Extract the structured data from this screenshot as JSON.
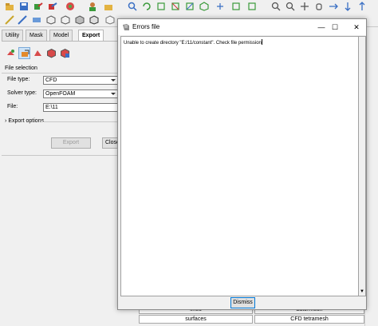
{
  "panel": {
    "tabs": [
      "Utility",
      "Mask",
      "Model",
      "Export"
    ],
    "active_tab": "Export",
    "section_title": "File selection",
    "fields": [
      {
        "label": "File type:",
        "value": "CFD",
        "kind": "combo"
      },
      {
        "label": "Solver type:",
        "value": "OpenFOAM",
        "kind": "combo"
      },
      {
        "label": "File:",
        "value": "E:\\11",
        "kind": "text"
      }
    ],
    "export_options_label": "Export options",
    "export_button": "Export",
    "close_button": "Close"
  },
  "bottom_table": {
    "row1": [
      "lines",
      "autormesh"
    ],
    "row2": [
      "surfaces",
      "CFD tetramesh"
    ]
  },
  "dialog": {
    "title": "Errors file",
    "minimize": "—",
    "maximize": "☐",
    "close": "✕",
    "message": "Unable to create directory \"E:/11/constant\". Check file permission",
    "dismiss_label": "Dismiss"
  },
  "colors": {
    "accent": "#0078d7",
    "selected_icon_bg": "#cde3f7"
  }
}
